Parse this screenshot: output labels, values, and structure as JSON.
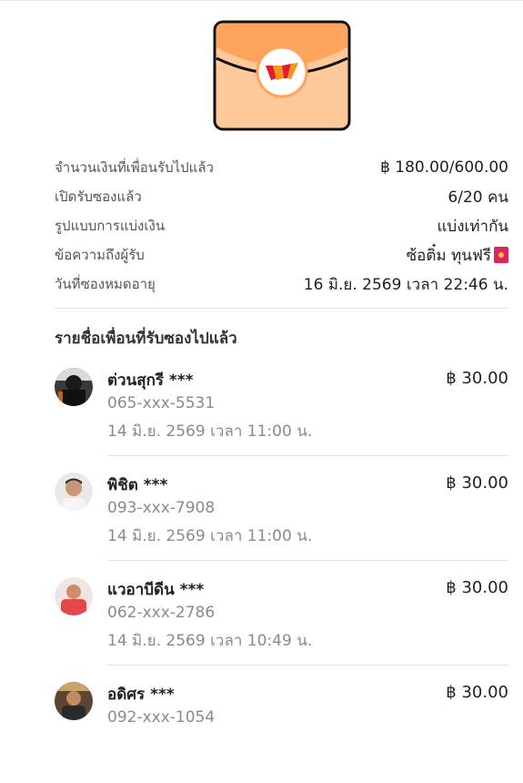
{
  "details": [
    {
      "label": "จำนวนเงินที่เพื่อนรับไปแล้ว",
      "value": "฿ 180.00/600.00"
    },
    {
      "label": "เปิดรับซองแล้ว",
      "value": "6/20 คน"
    },
    {
      "label": "รูปแบบการแบ่งเงิน",
      "value": "แบ่งเท่ากัน"
    },
    {
      "label": "ข้อความถึงผู้รับ",
      "value": "ซ้อติ๋ม ทุนฟรี"
    },
    {
      "label": "วันที่ซองหมดอายุ",
      "value": "16 มิ.ย. 2569 เวลา 22:46 น."
    }
  ],
  "section_title": "รายชื่อเพื่อนที่รับซองไปแล้ว",
  "recipients": [
    {
      "name": "ต่วนสุกรี ***",
      "amount": "฿ 30.00",
      "phone": "065-xxx-5531",
      "time": "14 มิ.ย. 2569 เวลา 11:00 น."
    },
    {
      "name": "พิชิต ***",
      "amount": "฿ 30.00",
      "phone": "093-xxx-7908",
      "time": "14 มิ.ย. 2569 เวลา 11:00 น."
    },
    {
      "name": "แวอาบีดีน ***",
      "amount": "฿ 30.00",
      "phone": "062-xxx-2786",
      "time": "14 มิ.ย. 2569 เวลา 10:49 น."
    },
    {
      "name": "อดิศร ***",
      "amount": "฿ 30.00",
      "phone": "092-xxx-1054",
      "time": ""
    }
  ],
  "colors": {
    "envelope_fill": "#ffc99a",
    "envelope_flap": "#ffa45c",
    "envelope_outline": "#111111",
    "logo_red": "#e11d2e",
    "logo_orange": "#f7941d",
    "label_text": "#555555",
    "muted_text": "#8a8a8a",
    "divider": "#e3e3e3"
  },
  "icons": {
    "envelope": "envelope-icon",
    "message_envelope": "red-envelope-emoji",
    "logo": "truemoney-logo-icon"
  }
}
